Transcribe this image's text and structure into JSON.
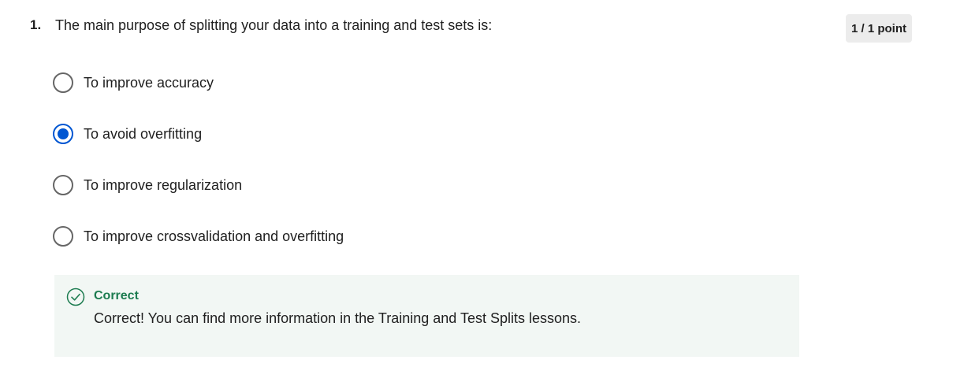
{
  "question": {
    "number": "1.",
    "text": "The main purpose of splitting your data into a training and test sets is:",
    "score": "1 / 1 point"
  },
  "options": [
    {
      "label": "To improve accuracy",
      "selected": false
    },
    {
      "label": "To avoid overfitting",
      "selected": true
    },
    {
      "label": "To improve regularization",
      "selected": false
    },
    {
      "label": "To improve crossvalidation and overfitting",
      "selected": false
    }
  ],
  "feedback": {
    "title": "Correct",
    "text": "Correct! You can find more information in the Training and Test Splits lessons.",
    "icon": "check-circle-icon"
  },
  "colors": {
    "selected": "#0056d2",
    "correct": "#1d7c50",
    "feedback_bg": "#f2f7f4",
    "badge_bg": "#ececec"
  }
}
